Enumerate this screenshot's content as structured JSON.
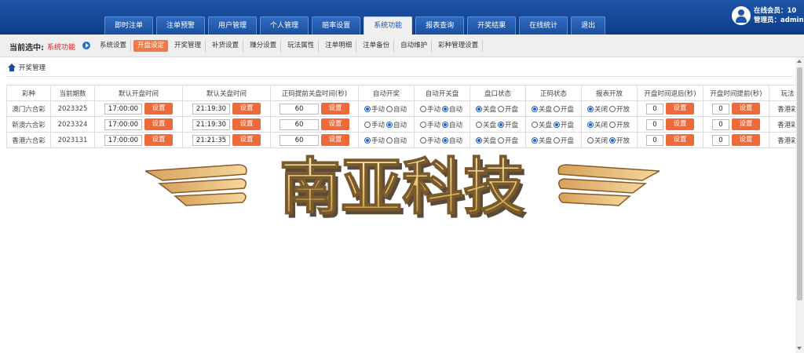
{
  "topnav": {
    "tabs": [
      "即时注单",
      "注单预警",
      "用户管理",
      "个人管理",
      "赔率设置",
      "系统功能",
      "报表查询",
      "开奖结果",
      "在线统计",
      "退出"
    ],
    "active_index": 5
  },
  "user": {
    "online_label": "在线会员：10",
    "admin_label": "管理员：admin"
  },
  "subbar": {
    "current_label": "当前选中:",
    "current_value": "系统功能",
    "tabs": [
      "系统设置",
      "开盘设定",
      "开奖管理",
      "补货设置",
      "赚分设置",
      "玩法属性",
      "注单明细",
      "注单备份",
      "自动维护",
      "彩种管理设置"
    ],
    "active_index": 1
  },
  "breadcrumb": {
    "text": "开奖管理"
  },
  "table": {
    "headers": [
      "彩种",
      "当前期数",
      "默认开盘时间",
      "默认关盘时间",
      "正码提前关盘时间(秒)",
      "自动开奖",
      "自动开关盘",
      "盘口状态",
      "正码状态",
      "报表开放",
      "开盘时间退后(秒)",
      "开盘时间提前(秒)",
      "玩法"
    ],
    "button_label": "设置",
    "radio_labels": {
      "manual": "手动",
      "auto": "自动",
      "close": "关盘",
      "open": "开盘",
      "off": "关闭",
      "on": "开放"
    },
    "rows": [
      {
        "name": "澳门六合彩",
        "issue": "2023325",
        "open_time": "17:00:00",
        "close_time": "21:19:30",
        "advance": "60",
        "auto_draw": "manual",
        "auto_switch": "auto",
        "pan": "close",
        "zheng": "close",
        "report": "off",
        "delay": "0",
        "early": "0",
        "play": "香港彩"
      },
      {
        "name": "新澳六合彩",
        "issue": "2023324",
        "open_time": "17:00:00",
        "close_time": "21:19:30",
        "advance": "60",
        "auto_draw": "auto",
        "auto_switch": "auto",
        "pan": "open",
        "zheng": "open",
        "report": "off",
        "delay": "0",
        "early": "0",
        "play": "香港彩"
      },
      {
        "name": "香港六合彩",
        "issue": "2023131",
        "open_time": "17:00:00",
        "close_time": "21:21:35",
        "advance": "60",
        "auto_draw": "manual",
        "auto_switch": "auto",
        "pan": "close",
        "zheng": "close",
        "report": "on",
        "delay": "0",
        "early": "0",
        "play": "香港彩"
      }
    ]
  },
  "watermark": {
    "text": "南亚科技"
  }
}
